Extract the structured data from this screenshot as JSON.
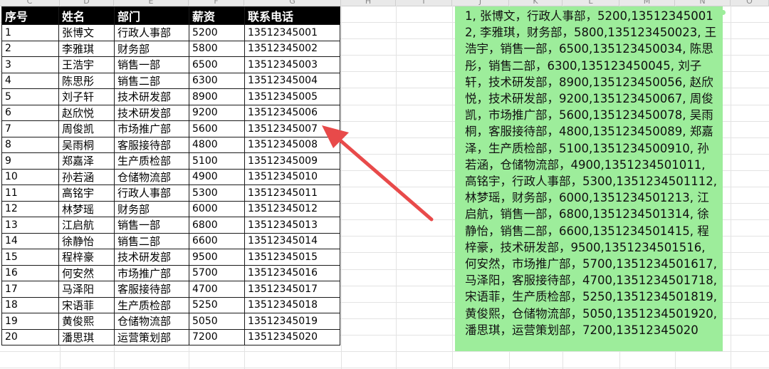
{
  "table": {
    "headers": [
      "序号",
      "姓名",
      "部门",
      "薪资",
      "联系电话"
    ],
    "rows": [
      [
        "1",
        "张博文",
        "行政人事部",
        "5200",
        "13512345001"
      ],
      [
        "2",
        "李雅琪",
        "财务部",
        "5800",
        "13512345002"
      ],
      [
        "3",
        "王浩宇",
        "销售一部",
        "6500",
        "13512345003"
      ],
      [
        "4",
        "陈思彤",
        "销售二部",
        "6300",
        "13512345004"
      ],
      [
        "5",
        "刘子轩",
        "技术研发部",
        "8900",
        "13512345005"
      ],
      [
        "6",
        "赵欣悦",
        "技术研发部",
        "9200",
        "13512345006"
      ],
      [
        "7",
        "周俊凯",
        "市场推广部",
        "5600",
        "13512345007"
      ],
      [
        "8",
        "吴雨桐",
        "客服接待部",
        "4800",
        "13512345008"
      ],
      [
        "9",
        "郑嘉泽",
        "生产质检部",
        "5100",
        "13512345009"
      ],
      [
        "10",
        "孙若涵",
        "仓储物流部",
        "4900",
        "13512345010"
      ],
      [
        "11",
        "高铭宇",
        "行政人事部",
        "5300",
        "13512345011"
      ],
      [
        "12",
        "林梦瑶",
        "财务部",
        "6000",
        "13512345012"
      ],
      [
        "13",
        "江启航",
        "销售一部",
        "6800",
        "13512345013"
      ],
      [
        "14",
        "徐静怡",
        "销售二部",
        "6600",
        "13512345014"
      ],
      [
        "15",
        "程梓豪",
        "技术研发部",
        "9500",
        "13512345015"
      ],
      [
        "16",
        "何安然",
        "市场推广部",
        "5700",
        "13512345016"
      ],
      [
        "17",
        "马泽阳",
        "客服接待部",
        "4700",
        "13512345017"
      ],
      [
        "18",
        "宋语菲",
        "生产质检部",
        "5250",
        "13512345018"
      ],
      [
        "19",
        "黄俊熙",
        "仓储物流部",
        "5050",
        "13512345019"
      ],
      [
        "20",
        "潘思琪",
        "运营策划部",
        "7200",
        "13512345020"
      ]
    ]
  },
  "text_box": {
    "content": "1, 张博文，行政人事部，5200,135123450012, 李雅琪，财务部，5800,135123450023, 王浩宇，销售一部，6500,135123450034, 陈思彤，销售二部，6300,135123450045, 刘子轩，技术研发部，8900,135123450056, 赵欣悦，技术研发部，9200,135123450067, 周俊凯，市场推广部，5600,135123450078, 吴雨桐，客服接待部，4800,135123450089, 郑嘉泽，生产质检部，5100,1351234500910, 孙若涵，仓储物流部，4900,1351234501011, 高铭宇，行政人事部，5300,1351234501112, 林梦瑶，财务部，6000,1351234501213, 江启航，销售一部，6800,1351234501314, 徐静怡，销售二部，6600,1351234501415, 程梓豪，技术研发部，9500,1351234501516, 何安然，市场推广部，5700,1351234501617, 马泽阳，客服接待部，4700,1351234501718, 宋语菲，生产质检部，5250,1351234501819, 黄俊熙，仓储物流部，5050,1351234501920, 潘思琪，运营策划部，7200,13512345020",
    "background": "#9ded9b"
  },
  "column_letters": [
    "C",
    "D",
    "E",
    "F",
    "G",
    "H",
    "I",
    "J",
    "K",
    "L",
    "M",
    "N",
    "O"
  ],
  "colors": {
    "arrow": "#e84a4a",
    "header_bg": "#000000",
    "header_text": "#ffffff"
  }
}
